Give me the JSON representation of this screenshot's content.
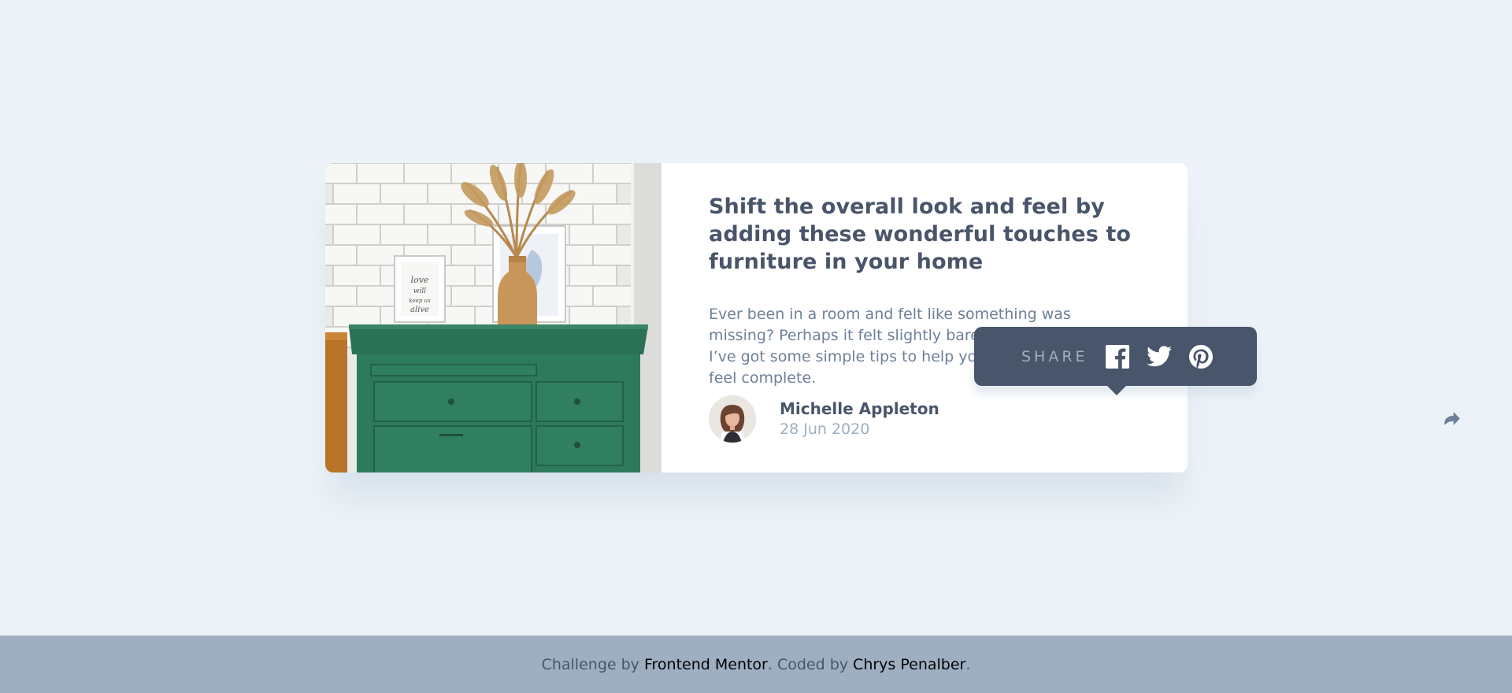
{
  "article": {
    "title": "Shift the overall look and feel by adding these wonderful touches to furniture in your home",
    "excerpt": "Ever been in a room and felt like something was missing? Perhaps it felt slightly bare and uninviting. I’ve got some simple tips to help you make any room feel complete.",
    "image_alt": "drawers"
  },
  "author": {
    "name": "Michelle Appleton",
    "date": "28 Jun 2020"
  },
  "share": {
    "label": "SHARE",
    "icons": [
      "facebook-icon",
      "twitter-icon",
      "pinterest-icon"
    ],
    "button_icon": "share-icon"
  },
  "footer": {
    "prefix": "Challenge by ",
    "link1": "Frontend Mentor",
    "middle": ". Coded by ",
    "link2": "Chrys Penalber",
    "suffix": "."
  },
  "colors": {
    "background": "#ecf2f8",
    "heading": "#48556a",
    "text": "#6e8098",
    "muted": "#9eafc2",
    "tooltip": "#48556a",
    "footer": "#9eafc2"
  }
}
